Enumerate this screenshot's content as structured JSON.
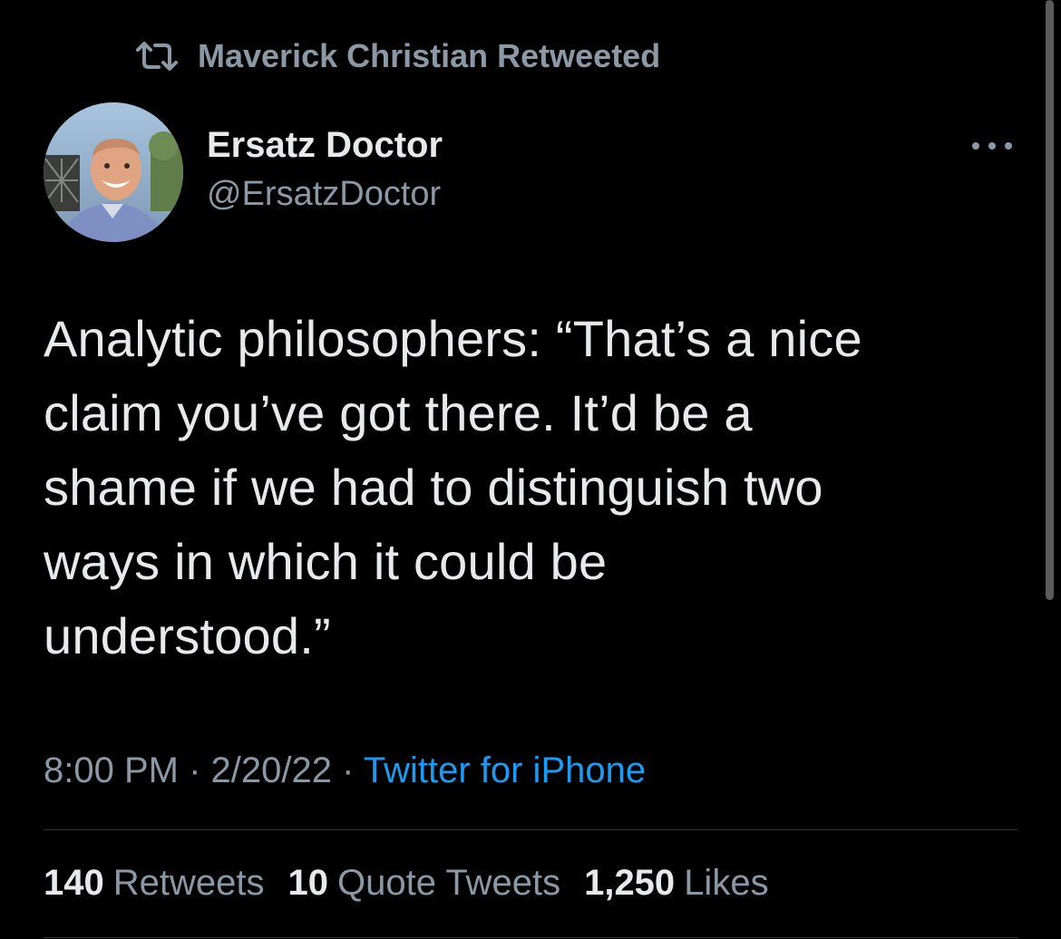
{
  "retweet_banner": {
    "icon": "retweet-icon",
    "text": "Maverick Christian Retweeted"
  },
  "author": {
    "display_name": "Ersatz Doctor",
    "handle": "@ErsatzDoctor",
    "avatar_icon": "avatar-photo"
  },
  "more_icon": "more-horizontal-icon",
  "tweet": {
    "lines": [
      "Analytic philosophers: “That’s a nice",
      "claim you’ve got there. It’d be a",
      "shame if we had to distinguish two",
      "ways in which it could be",
      "understood.”"
    ]
  },
  "meta": {
    "time": "8:00 PM",
    "date": "2/20/22",
    "separator": "·",
    "source": "Twitter for iPhone"
  },
  "stats": {
    "retweets_count": "140",
    "retweets_label": "Retweets",
    "quotes_count": "10",
    "quotes_label": "Quote Tweets",
    "likes_count": "1,250",
    "likes_label": "Likes"
  },
  "colors": {
    "background": "#000000",
    "primary_text": "#e7e9ea",
    "secondary_text": "#8b98a5",
    "link": "#1d9bf0",
    "divider": "#2f3336"
  }
}
